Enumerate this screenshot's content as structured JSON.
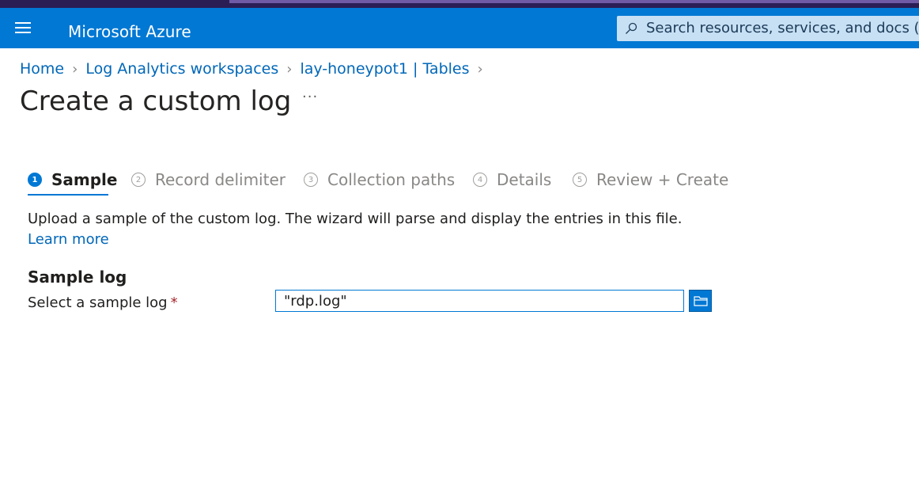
{
  "app": {
    "brand": "Microsoft Azure",
    "search_placeholder": "Search resources, services, and docs (G+/)"
  },
  "breadcrumb": [
    "Home",
    "Log Analytics workspaces",
    "lay-honeypot1 | Tables"
  ],
  "page": {
    "title": "Create a custom log",
    "more": "···"
  },
  "wizard": {
    "steps": [
      {
        "number": "1",
        "label": "Sample"
      },
      {
        "number": "2",
        "label": "Record delimiter"
      },
      {
        "number": "3",
        "label": "Collection paths"
      },
      {
        "number": "4",
        "label": "Details"
      },
      {
        "number": "5",
        "label": "Review + Create"
      }
    ],
    "active_step": 1
  },
  "description": {
    "text": "Upload a sample of the custom log. The wizard will parse and display the entries in this file. ",
    "link": "Learn more"
  },
  "sample_log": {
    "section_title": "Sample log",
    "field_label": "Select a sample log",
    "required_marker": "*",
    "value": "\"rdp.log\""
  },
  "icons": {
    "menu": "hamburger-icon",
    "search": "search-icon",
    "breadcrumb_separator": "chevron-right-icon",
    "browse": "folder-icon"
  },
  "colors": {
    "header": "#0078d4",
    "link": "#0067b8",
    "required": "#a4262c"
  }
}
